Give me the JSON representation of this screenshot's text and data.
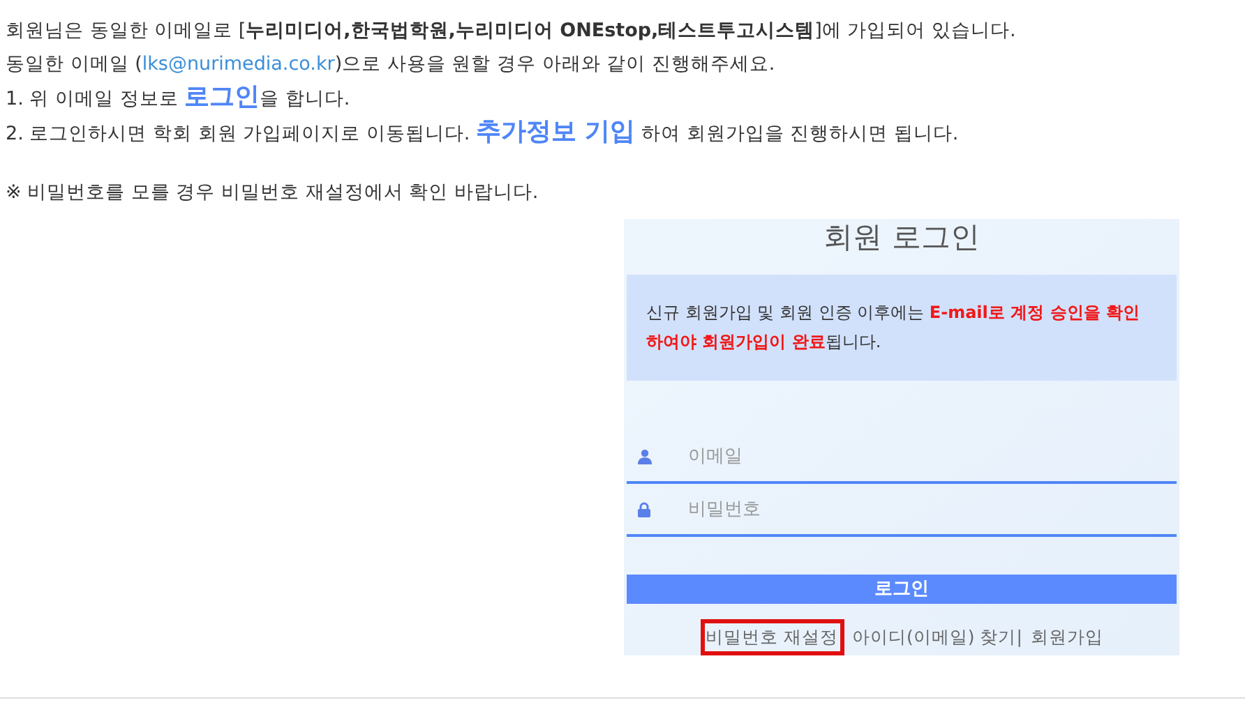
{
  "notice": [
    {
      "segments": [
        {
          "kind": "text",
          "text": "회원님은 동일한 이메일로 [**누리미디어,한국법학원,누리미디어 ONEstop,테스트투고시스템**]에 가입되어 있습니다."
        }
      ]
    },
    {
      "segments": [
        {
          "kind": "text",
          "text": "동일한 이메일 ("
        },
        {
          "kind": "link",
          "text": "lks@nurimedia.co.kr"
        },
        {
          "kind": "text",
          "text": ")으로 사용을 원할 경우 아래와 같이 진행해주세요."
        }
      ]
    },
    {
      "segments": [
        {
          "kind": "text",
          "text": "1. 위 이메일 정보로 "
        },
        {
          "kind": "emphasis",
          "text": "로그인"
        },
        {
          "kind": "text",
          "text": "을 합니다."
        }
      ]
    },
    {
      "segments": [
        {
          "kind": "text",
          "text": "2. 로그인하시면 학회 회원 가입페이지로 이동됩니다. "
        },
        {
          "kind": "emphasis",
          "text": "추가정보 기입"
        },
        {
          "kind": "text",
          "text": " 하여 회원가입을 진행하시면 됩니다."
        }
      ]
    }
  ],
  "note": "※ 비밀번호를 모를 경우 비밀번호 재설정에서 확인 바랍니다.",
  "login": {
    "title": "회원 로그인",
    "alert": "신규 회원가입 및 회원 인증 이후에는 **E-mail로 계정 승인을 확인 하여야 회원가입이 완료**됩니다.",
    "fields": [
      {
        "kind": "user",
        "placeholder": "이메일"
      },
      {
        "kind": "lock",
        "placeholder": "비밀번호"
      }
    ],
    "button": "로그인",
    "links": [
      {
        "text": "비밀번호 재설정",
        "highlighted": true
      },
      {
        "text": "아이디(이메일) 찾기|",
        "highlighted": false
      },
      {
        "text": "회원가입",
        "highlighted": false
      }
    ]
  }
}
